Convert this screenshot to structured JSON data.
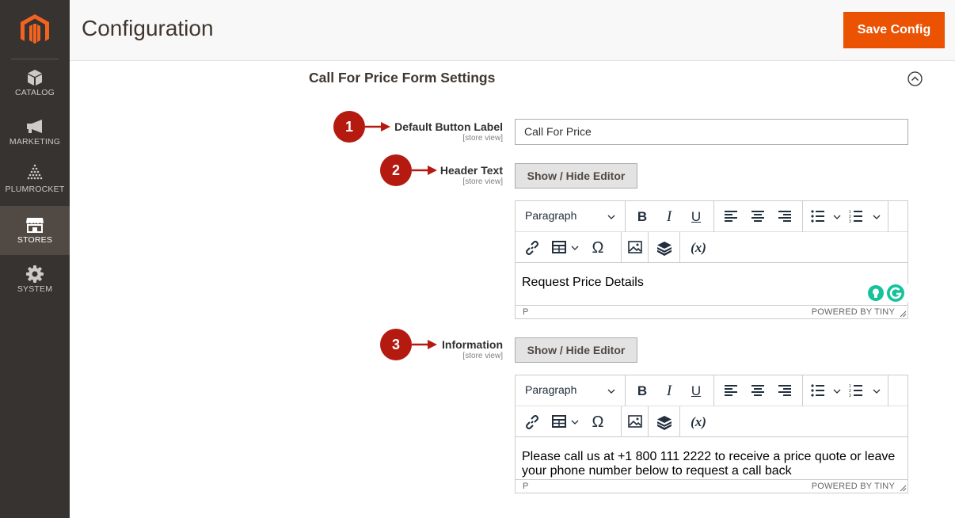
{
  "sidebar": {
    "items": [
      {
        "label": "CATALOG",
        "icon": "catalog-icon"
      },
      {
        "label": "MARKETING",
        "icon": "megaphone-icon"
      },
      {
        "label": "PLUMROCKET",
        "icon": "plumrocket-icon"
      },
      {
        "label": "STORES",
        "icon": "store-icon",
        "active": true
      },
      {
        "label": "SYSTEM",
        "icon": "gear-icon"
      }
    ]
  },
  "header": {
    "title": "Configuration",
    "save_label": "Save Config"
  },
  "section": {
    "title": "Call For Price Form Settings"
  },
  "callouts": [
    "1",
    "2",
    "3"
  ],
  "fields": {
    "default_button_label": {
      "label": "Default Button Label",
      "scope": "[store view]",
      "value": "Call For Price"
    },
    "header_text": {
      "label": "Header Text",
      "scope": "[store view]",
      "toggle_label": "Show / Hide Editor",
      "content": "Request Price Details"
    },
    "information": {
      "label": "Information",
      "scope": "[store view]",
      "toggle_label": "Show / Hide Editor",
      "content": "Please call us at +1 800 111 2222 to receive a price quote or leave your phone number below to request a call back"
    }
  },
  "editor": {
    "format_value": "Paragraph",
    "variable_label": "(x)",
    "omega": "Ω",
    "status_path": "P",
    "powered_by": "POWERED BY TINY"
  },
  "colors": {
    "accent": "#eb5202",
    "sidebar": "#373330",
    "callout": "#b51a10"
  }
}
